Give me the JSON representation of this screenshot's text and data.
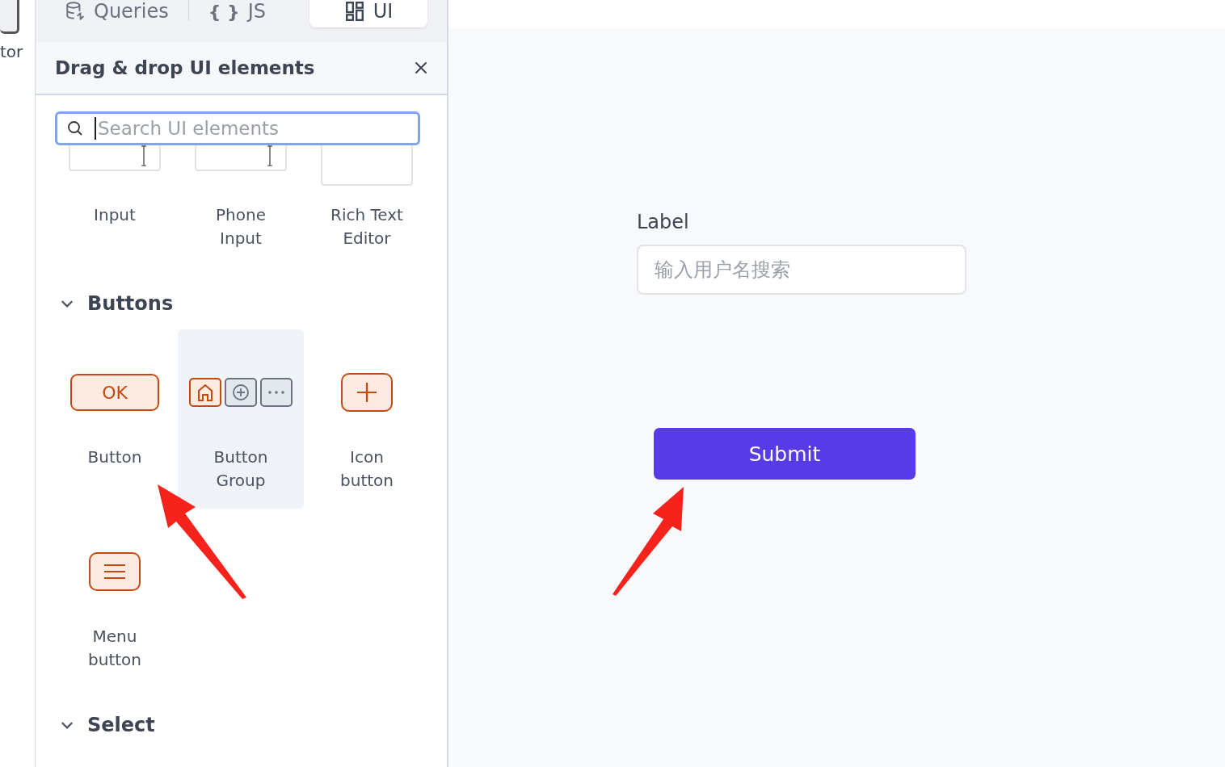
{
  "left_rail": {
    "label": "tor"
  },
  "tabs": [
    {
      "label": "Queries",
      "kind": "queries",
      "selected": false
    },
    {
      "label": "JS",
      "kind": "js",
      "icon_text": "{ }",
      "selected": false
    },
    {
      "label": "UI",
      "kind": "ui",
      "selected": true
    }
  ],
  "panel": {
    "title": "Drag & drop UI elements"
  },
  "search": {
    "placeholder": "Search UI elements"
  },
  "groups": [
    {
      "items": [
        {
          "label": "Input",
          "kind": "input",
          "highlighted": false
        },
        {
          "label": "Phone Input",
          "kind": "phone",
          "highlighted": false
        },
        {
          "label": "Rich Text Editor",
          "kind": "richtext",
          "highlighted": false
        }
      ]
    },
    {
      "title": "Buttons",
      "expanded": true,
      "items": [
        {
          "label": "Button",
          "kind": "button",
          "preview_text": "OK",
          "highlighted": false
        },
        {
          "label": "Button Group",
          "kind": "button-group",
          "highlighted": true
        },
        {
          "label": "Icon button",
          "kind": "icon-button",
          "highlighted": false
        },
        {
          "label": "Menu button",
          "kind": "menu-button",
          "highlighted": false
        }
      ]
    },
    {
      "title": "Select",
      "expanded": true
    }
  ],
  "canvas": {
    "label": "Label",
    "input": {
      "placeholder": "输入用户名搜索"
    },
    "button": "Submit"
  },
  "annotations": [
    {
      "kind": "arrow"
    },
    {
      "kind": "arrow"
    }
  ]
}
